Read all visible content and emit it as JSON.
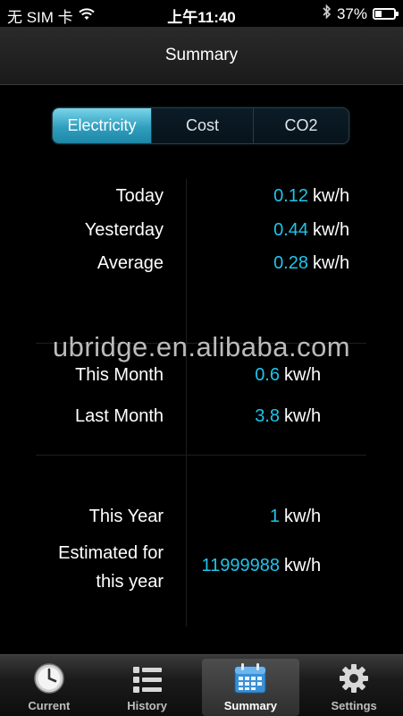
{
  "status_bar": {
    "carrier": "无 SIM 卡",
    "time": "上午11:40",
    "battery_percent_text": "37%",
    "battery_level": 0.37
  },
  "header": {
    "title": "Summary"
  },
  "segments": [
    {
      "label": "Electricity",
      "active": true
    },
    {
      "label": "Cost",
      "active": false
    },
    {
      "label": "CO2",
      "active": false
    }
  ],
  "daily": [
    {
      "label": "Today",
      "value": "0.12",
      "unit": "kw/h"
    },
    {
      "label": "Yesterday",
      "value": "0.44",
      "unit": "kw/h"
    },
    {
      "label": "Average",
      "value": "0.28",
      "unit": "kw/h"
    }
  ],
  "watermark": "ubridge.en.alibaba.com",
  "monthly": [
    {
      "label": "This Month",
      "value": "0.6",
      "unit": "kw/h"
    },
    {
      "label": "Last Month",
      "value": "3.8",
      "unit": "kw/h"
    }
  ],
  "yearly": [
    {
      "label": "This Year",
      "value": "1",
      "unit": "kw/h"
    },
    {
      "label_line1": "Estimated for",
      "label_line2": "this year",
      "value": "11999988",
      "unit": "kw/h"
    }
  ],
  "tabs": [
    {
      "label": "Current",
      "icon": "clock-icon",
      "active": false
    },
    {
      "label": "History",
      "icon": "list-icon",
      "active": false
    },
    {
      "label": "Summary",
      "icon": "calendar-icon",
      "active": true
    },
    {
      "label": "Settings",
      "icon": "gear-icon",
      "active": false
    }
  ],
  "colors": {
    "accent": "#1ec5ea",
    "segment_active": "#2f9fbe",
    "background": "#000000",
    "calendar_icon": "#3a8fd6"
  }
}
